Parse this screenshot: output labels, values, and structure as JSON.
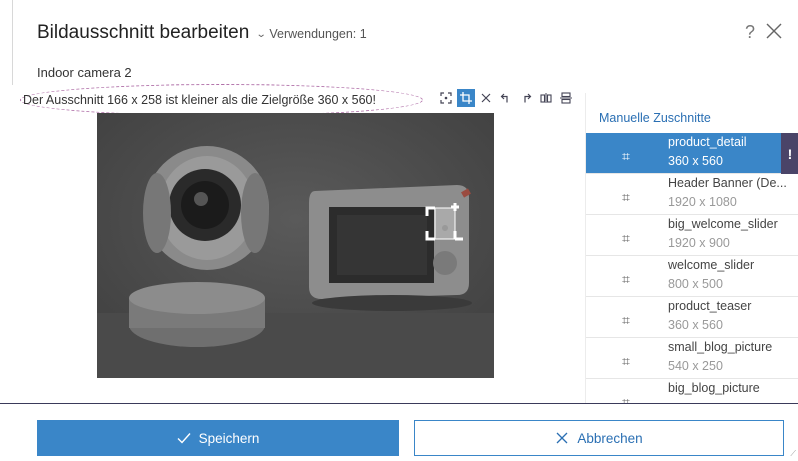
{
  "header": {
    "title": "Bildausschnitt bearbeiten",
    "usages": "Verwendungen: 1",
    "help": "?",
    "subtitle": "Indoor camera 2"
  },
  "warning": "Der Ausschnitt 166 x 258 ist kleiner als die Zielgröße 360 x 560!",
  "toolbar": {
    "icons": [
      "focus-crop-icon",
      "crop-icon",
      "close-icon",
      "rotate-left-icon",
      "rotate-right-icon",
      "flip-horizontal-icon",
      "flip-vertical-icon"
    ],
    "active": "crop-icon"
  },
  "sidebar": {
    "title": "Manuelle Zuschnitte",
    "glyph": "⌗",
    "items": [
      {
        "name": "product_detail",
        "size": "360 x 560",
        "selected": true,
        "badge": "!"
      },
      {
        "name": "Header Banner (De...",
        "size": "1920 x 1080"
      },
      {
        "name": "big_welcome_slider",
        "size": "1920 x 900"
      },
      {
        "name": "welcome_slider",
        "size": "800 x 500"
      },
      {
        "name": "product_teaser",
        "size": "360 x 560"
      },
      {
        "name": "small_blog_picture",
        "size": "540 x 250"
      },
      {
        "name": "big_blog_picture",
        "size": ""
      }
    ]
  },
  "footer": {
    "save_label": "Speichern",
    "cancel_label": "Abbrechen"
  },
  "colors": {
    "accent": "#3a86c8",
    "badge": "#4a4468",
    "warning_outline": "#b06fa8"
  }
}
